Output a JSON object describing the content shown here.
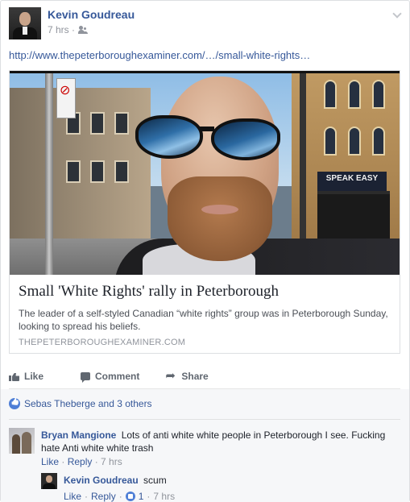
{
  "post": {
    "author": "Kevin Goudreau",
    "time": "7 hrs ·",
    "audience_icon": "friends-icon",
    "link_url": "http://www.thepeterboroughexaminer.com/…/small-white-rights…"
  },
  "card": {
    "title": "Small 'White Rights' rally in Peterborough",
    "description": "The leader of a self-styled Canadian “white rights” group was in Peterborough Sunday, looking to spread his beliefs.",
    "domain": "THEPETERBOROUGHEXAMINER.COM",
    "image_sign_text": "SPEAK EASY"
  },
  "actions": {
    "like": "Like",
    "comment": "Comment",
    "share": "Share"
  },
  "likes": {
    "text": "Sebas Theberge and 3 others"
  },
  "comments": [
    {
      "author": "Bryan Mangione",
      "text": "Lots of anti white white people in Peterborough I see. Fucking hate Anti white white trash",
      "like": "Like",
      "sep1": " · ",
      "reply": "Reply",
      "sep2": " · ",
      "time": "7 hrs"
    }
  ],
  "reply": {
    "author": "Kevin Goudreau",
    "text": "scum",
    "like": "Like",
    "sep1": " · ",
    "reply": "Reply",
    "sep2": " · ",
    "like_count": "1",
    "sep3": " · ",
    "time": "7 hrs"
  },
  "colors": {
    "link": "#365899",
    "meta": "#90949c",
    "like_blue": "#4f7fd6",
    "background_gray": "#f6f7f9"
  }
}
